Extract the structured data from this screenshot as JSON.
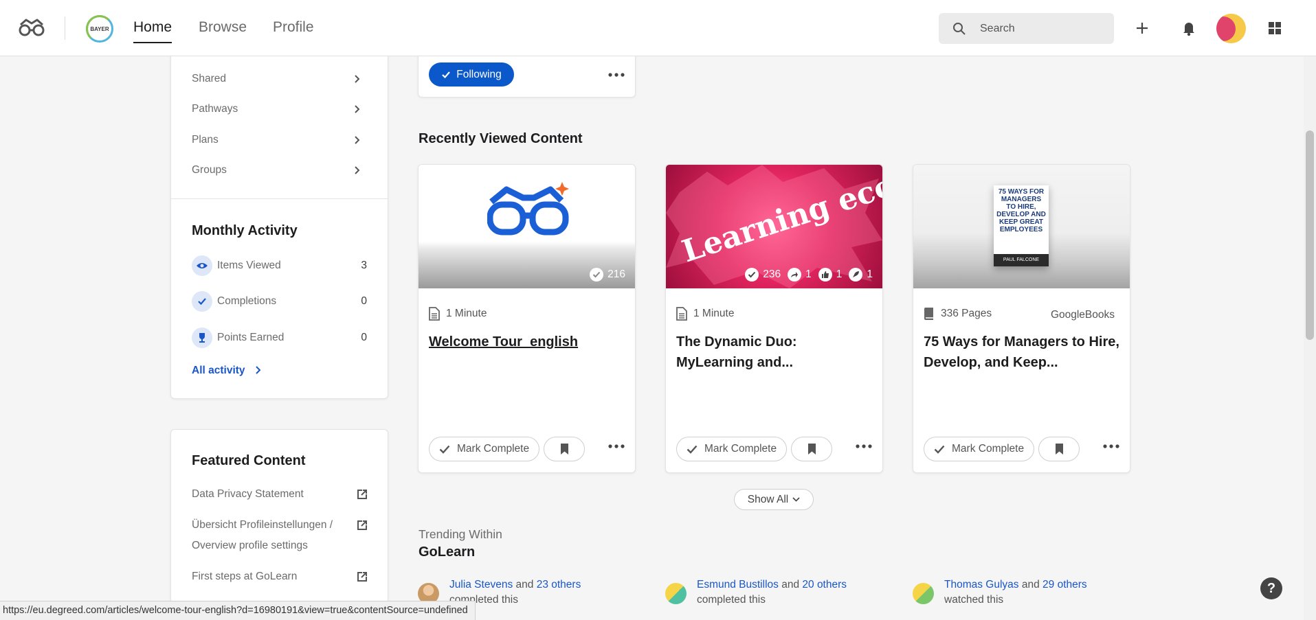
{
  "nav": {
    "tabs": [
      "Home",
      "Browse",
      "Profile"
    ],
    "bayer_logo_text": "BAYER",
    "search_placeholder": "Search"
  },
  "sidebar": {
    "links": [
      "Shared",
      "Pathways",
      "Plans",
      "Groups"
    ],
    "monthly_activity": {
      "title": "Monthly Activity",
      "items": [
        {
          "label": "Items Viewed",
          "value": "3",
          "icon": "eye-icon"
        },
        {
          "label": "Completions",
          "value": "0",
          "icon": "check-icon"
        },
        {
          "label": "Points Earned",
          "value": "0",
          "icon": "trophy-icon"
        }
      ],
      "all_activity": "All activity"
    },
    "featured": {
      "title": "Featured Content",
      "items": [
        "Data Privacy Statement",
        "Übersicht Profileinstellungen / Overview profile settings",
        "First steps at GoLearn"
      ]
    }
  },
  "main": {
    "following_label": "Following",
    "recently_viewed_title": "Recently Viewed Content",
    "cards": [
      {
        "completions": "216",
        "meta": "1 Minute",
        "provider": "",
        "title": "Welcome Tour_english"
      },
      {
        "image_text": "Learning ecosystem",
        "completions": "236",
        "shares": "1",
        "likes": "1",
        "recommends": "1",
        "meta": "1 Minute",
        "provider": "",
        "title": "The Dynamic Duo: MyLearning and..."
      },
      {
        "book_cover_text": "75 WAYS FOR MANAGERS TO HIRE, DEVELOP AND KEEP GREAT EMPLOYEES",
        "book_author": "PAUL FALCONE",
        "meta": "336 Pages",
        "provider": "GoogleBooks",
        "title": "75 Ways for Managers to Hire, Develop, and Keep..."
      }
    ],
    "mark_complete_label": "Mark Complete",
    "show_all_label": "Show All",
    "trending": {
      "subtitle": "Trending Within",
      "title": "GoLearn",
      "items": [
        {
          "name": "Julia Stevens",
          "and": "and",
          "others": "23 others",
          "action": "completed this"
        },
        {
          "name": "Esmund Bustillos",
          "and": "and",
          "others": "20 others",
          "action": "completed this"
        },
        {
          "name": "Thomas Gulyas",
          "and": "and",
          "others": "29 others",
          "action": "watched this"
        }
      ]
    }
  },
  "status_bar": "https://eu.degreed.com/articles/welcome-tour-english?d=16980191&view=true&contentSource=undefined",
  "help_label": "?",
  "colors": {
    "accent": "#0a58ca",
    "link": "#1a56c7",
    "card2_bg": "#d81b5a"
  }
}
